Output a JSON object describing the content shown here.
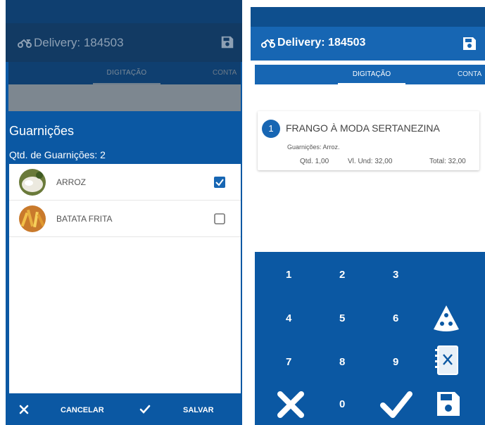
{
  "left_screen": {
    "appbar": {
      "title": "Delivery: 184503"
    },
    "tabs": {
      "active": "DIGITAÇÃO",
      "next": "CONTA"
    },
    "dialog": {
      "title": "Guarnições",
      "subtitle": "Qtd. de Guarnições: 2",
      "items": [
        {
          "label": "ARROZ",
          "checked": true,
          "thumb": "rice-thumbnail"
        },
        {
          "label": "BATATA FRITA",
          "checked": false,
          "thumb": "fries-thumbnail"
        }
      ],
      "buttons": {
        "cancel": "CANCELAR",
        "save": "SALVAR"
      }
    }
  },
  "right_screen": {
    "appbar": {
      "title": "Delivery: 184503"
    },
    "tabs": {
      "active": "DIGITAÇÃO",
      "next": "CONTA"
    },
    "order_item": {
      "number": "1",
      "name": "FRANGO À MODA SERTANEZINA",
      "note": "Guarnições: Arroz.",
      "qtd": "Qtd. 1,00",
      "unit_value": "Vl. Und: 32,00",
      "total": "Total: 32,00"
    },
    "keypad": {
      "keys": [
        "1",
        "2",
        "3",
        "4",
        "5",
        "6",
        "7",
        "8",
        "9",
        "0"
      ]
    }
  },
  "colors": {
    "primary": "#1766b3",
    "primary_dark": "#0b58a3",
    "status_bar": "#0e4f8e",
    "dim_overlay": "#123a63",
    "checkbox": "#1766b3"
  },
  "icons": [
    "delivery-motorbike-icon",
    "save-disk-icon",
    "close-icon",
    "check-icon",
    "pizza-icon",
    "menu-book-icon"
  ]
}
